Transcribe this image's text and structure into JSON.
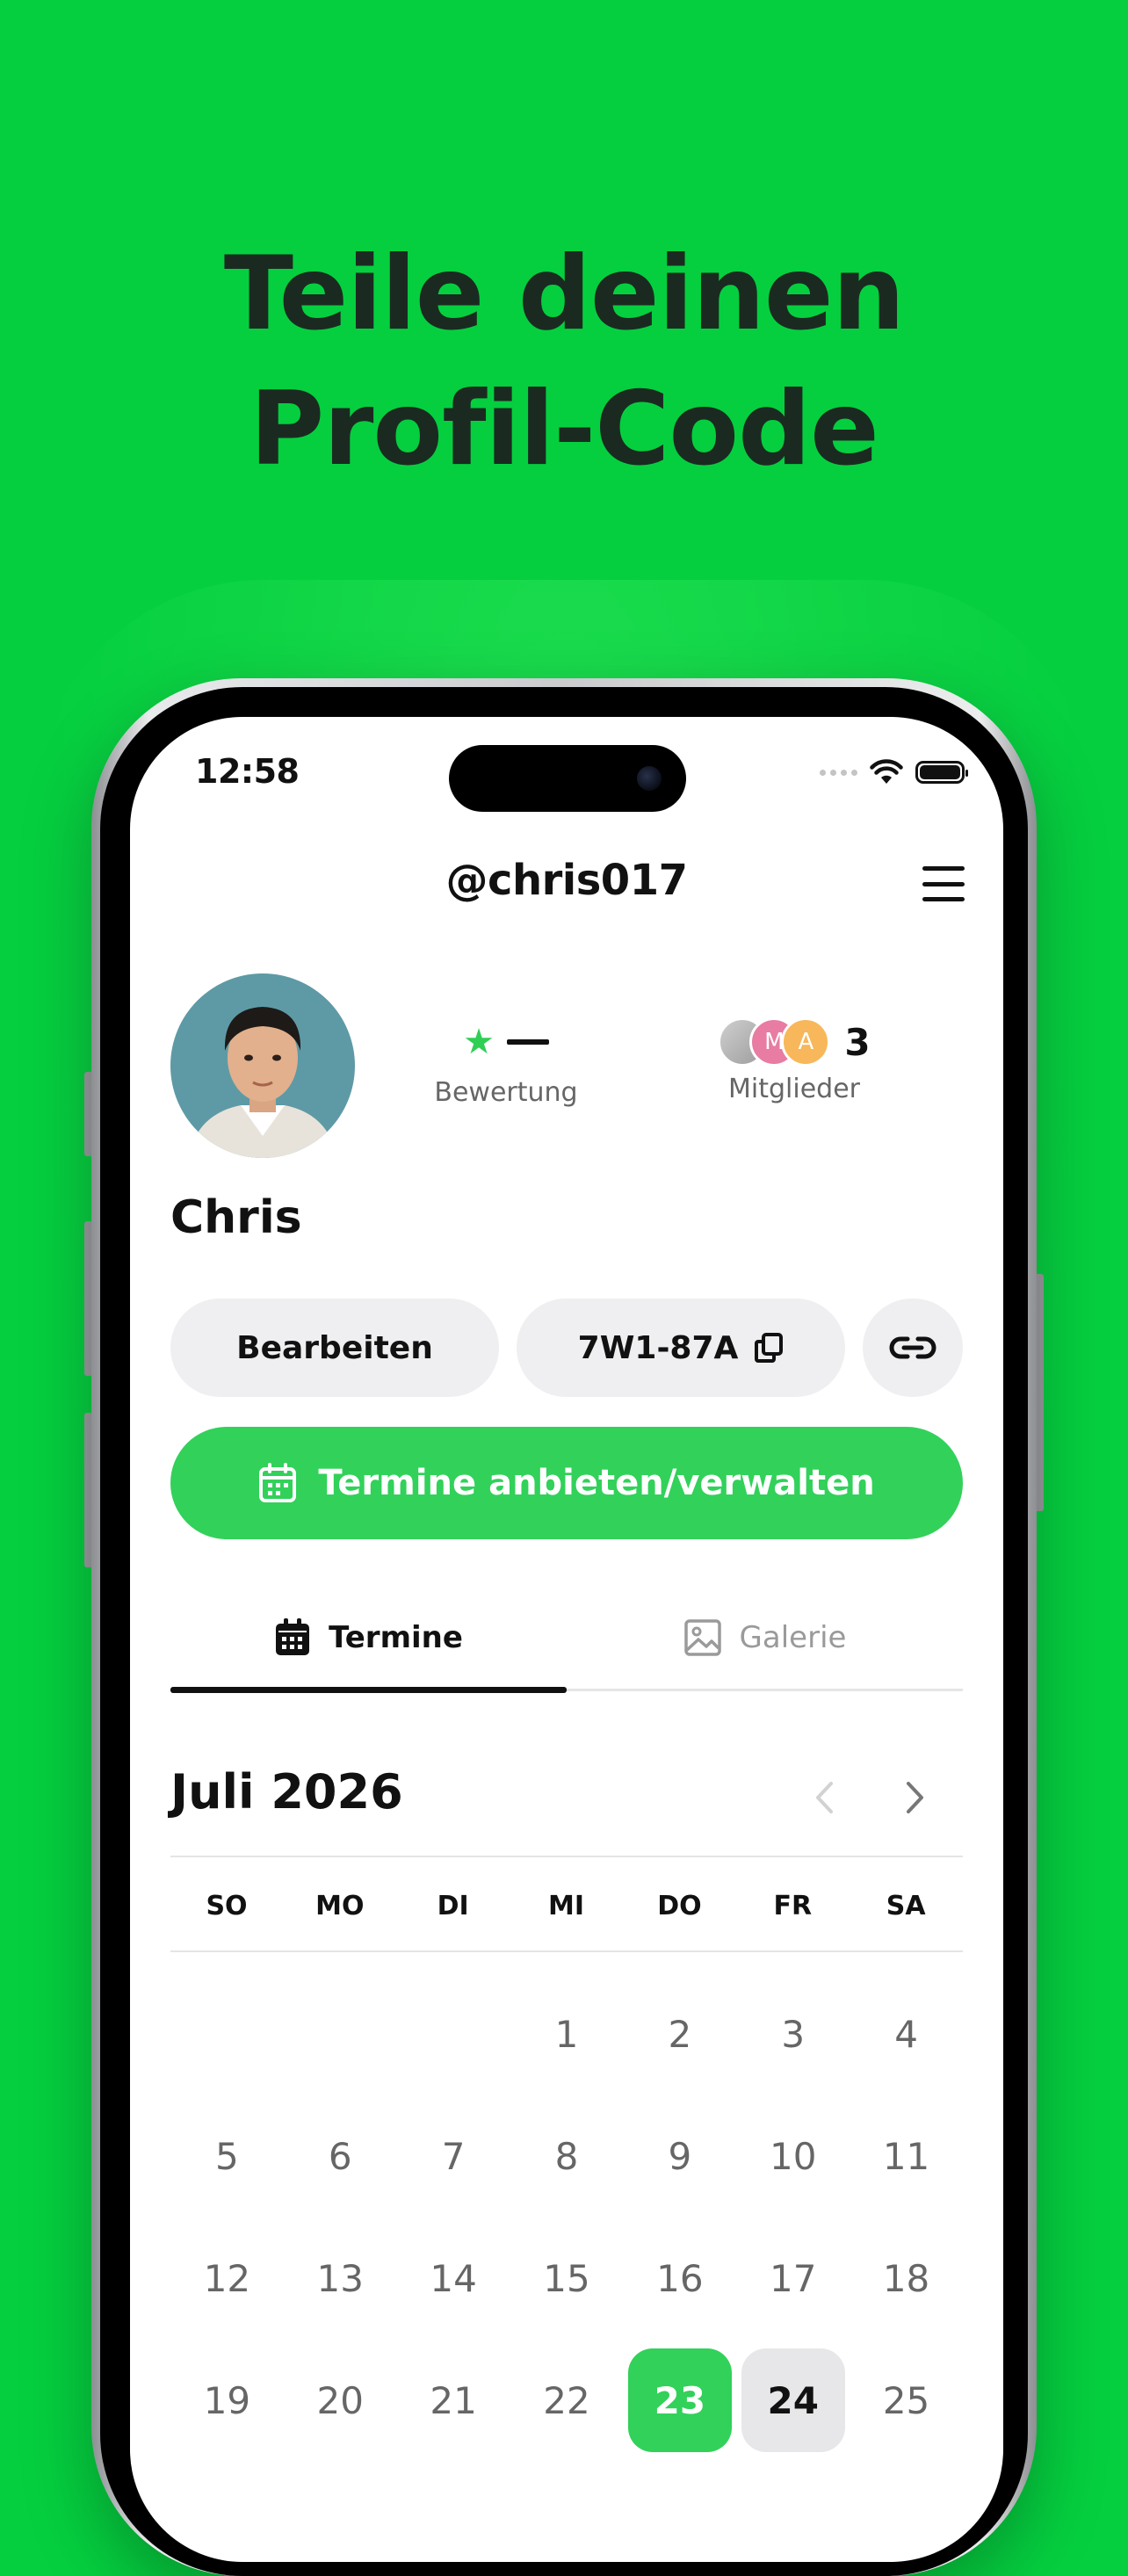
{
  "headline": {
    "line1": "Teile deinen",
    "line2": "Profil-Code"
  },
  "status_bar": {
    "time": "12:58"
  },
  "header": {
    "username": "@chris017"
  },
  "profile": {
    "name": "Chris",
    "rating": {
      "value": "—",
      "label": "Bewertung"
    },
    "members": {
      "count": "3",
      "label": "Mitglieder",
      "initials": [
        "M",
        "A"
      ]
    }
  },
  "actions": {
    "edit_label": "Bearbeiten",
    "code_label": "7W1-87A",
    "cta_label": "Termine anbieten/verwalten"
  },
  "tabs": [
    {
      "label": "Termine",
      "active": true
    },
    {
      "label": "Galerie",
      "active": false
    }
  ],
  "calendar": {
    "month_label": "Juli 2026",
    "weekdays": [
      "SO",
      "MO",
      "DI",
      "MI",
      "DO",
      "FR",
      "SA"
    ],
    "weeks": [
      [
        "",
        "",
        "",
        "1",
        "2",
        "3",
        "4"
      ],
      [
        "5",
        "6",
        "7",
        "8",
        "9",
        "10",
        "11"
      ],
      [
        "12",
        "13",
        "14",
        "15",
        "16",
        "17",
        "18"
      ],
      [
        "19",
        "20",
        "21",
        "22",
        "23",
        "24",
        "25"
      ]
    ],
    "today": "23",
    "selected": "24"
  },
  "colors": {
    "background": "#05cf3f",
    "accent": "#32d15a",
    "text": "#111111"
  }
}
